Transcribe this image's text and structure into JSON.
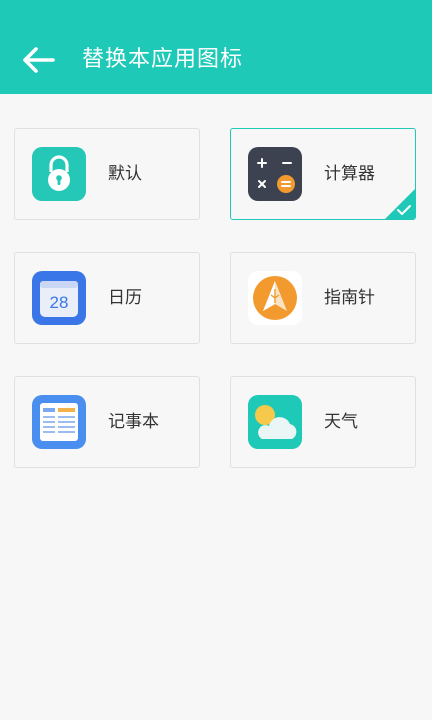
{
  "header": {
    "title": "替换本应用图标",
    "background": "#1fc9b8"
  },
  "icons": [
    {
      "label": "默认",
      "icon": "lock-icon",
      "selected": false
    },
    {
      "label": "计算器",
      "icon": "calculator-icon",
      "selected": true
    },
    {
      "label": "日历",
      "icon": "calendar-icon",
      "selected": false,
      "icon_text": "28"
    },
    {
      "label": "指南针",
      "icon": "compass-icon",
      "selected": false
    },
    {
      "label": "记事本",
      "icon": "notepad-icon",
      "selected": false
    },
    {
      "label": "天气",
      "icon": "weather-icon",
      "selected": false
    }
  ],
  "colors": {
    "accent": "#1fc9b8",
    "card_border": "#e0e0e0",
    "background": "#f7f7f7"
  }
}
